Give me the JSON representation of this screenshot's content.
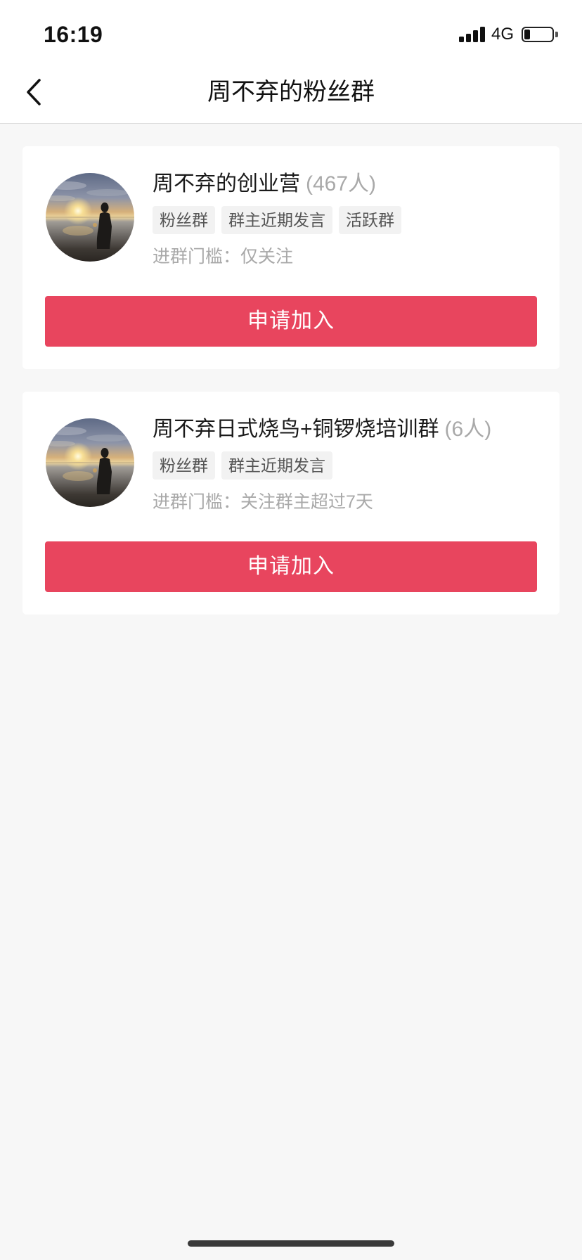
{
  "status_bar": {
    "time": "16:19",
    "network": "4G",
    "battery_level": 0.2,
    "icons": [
      "signal-icon",
      "battery-icon"
    ]
  },
  "nav": {
    "back_icon": "chevron-left-icon",
    "title": "周不弃的粉丝群"
  },
  "groups": [
    {
      "name": "周不弃的创业营",
      "count": "(467人)",
      "tags": [
        "粉丝群",
        "群主近期发言",
        "活跃群"
      ],
      "threshold": "进群门槛：仅关注",
      "button_label": "申请加入"
    },
    {
      "name": "周不弃日式烧鸟+铜锣烧培训群",
      "count": "(6人)",
      "tags": [
        "粉丝群",
        "群主近期发言"
      ],
      "threshold": "进群门槛：关注群主超过7天",
      "button_label": "申请加入"
    }
  ],
  "colors": {
    "accent": "#e8455e",
    "page_background": "#f7f7f7",
    "muted_text": "#a9a9a9"
  }
}
